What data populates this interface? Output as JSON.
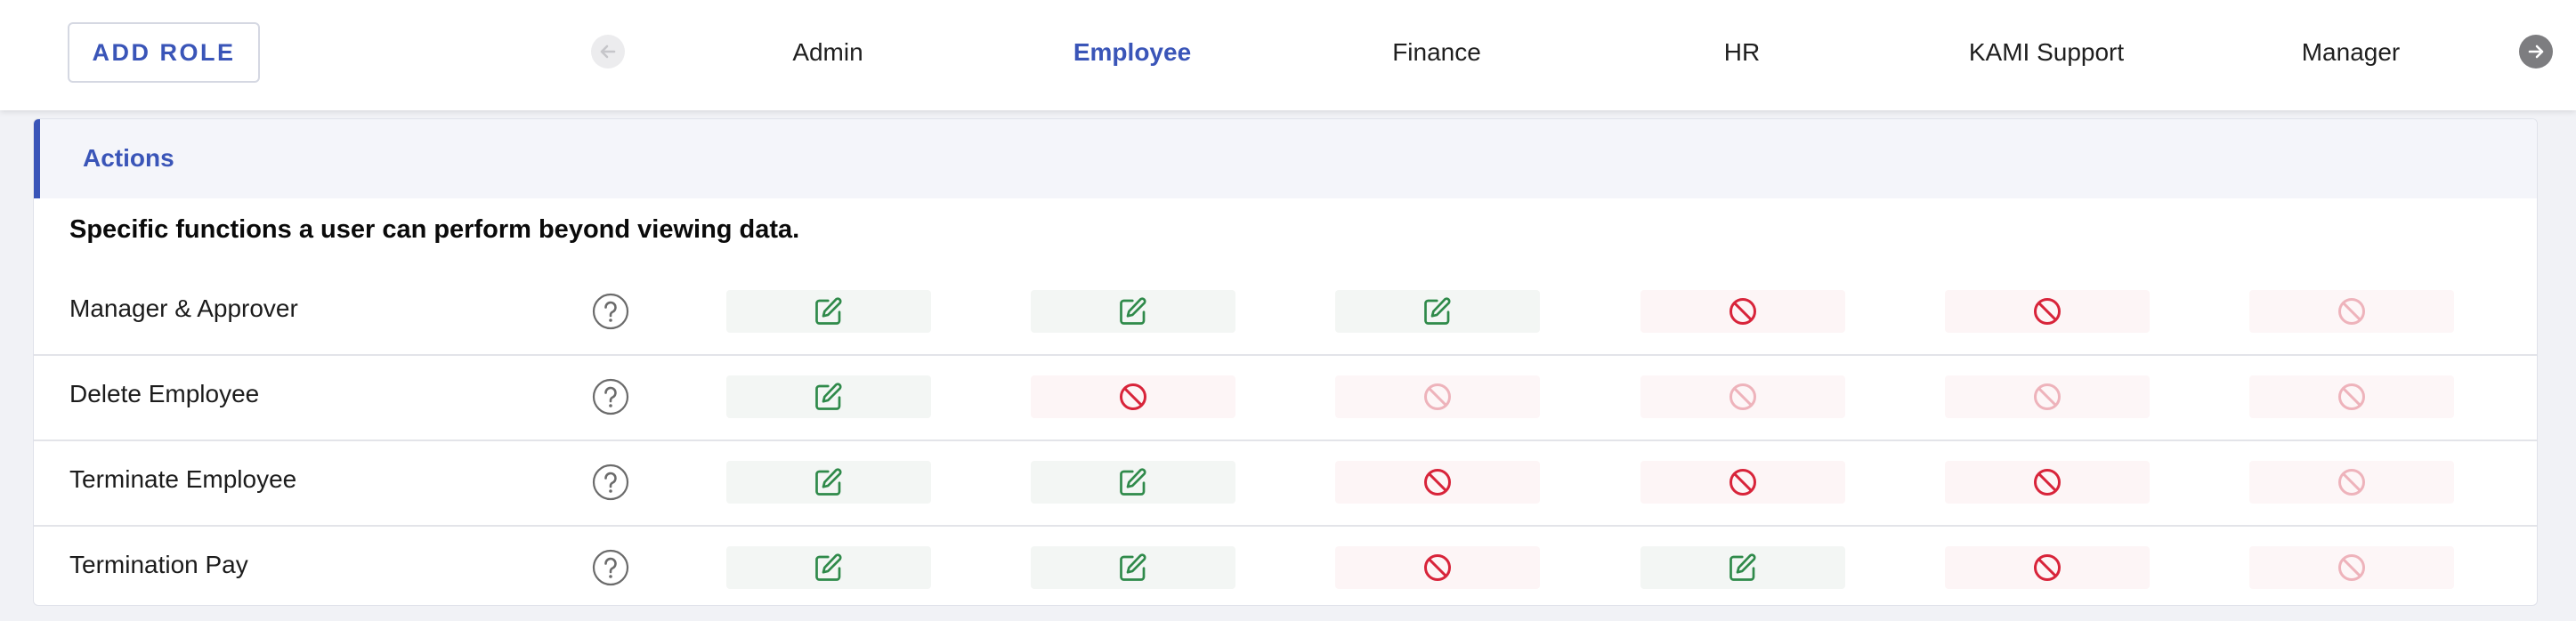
{
  "toolbar": {
    "add_role_label": "ADD ROLE",
    "prev_arrow_icon": "arrow-left-icon",
    "next_arrow_icon": "arrow-right-icon"
  },
  "roles": [
    {
      "label": "Admin",
      "active": false
    },
    {
      "label": "Employee",
      "active": true
    },
    {
      "label": "Finance",
      "active": false
    },
    {
      "label": "HR",
      "active": false
    },
    {
      "label": "KAMI Support",
      "active": false
    },
    {
      "label": "Manager",
      "active": false
    }
  ],
  "section": {
    "title": "Actions",
    "description": "Specific functions a user can perform beyond viewing data."
  },
  "permissions": [
    {
      "label": "Manager & Approver",
      "cells": [
        "edit",
        "edit",
        "edit",
        "deny",
        "deny",
        "disabled"
      ]
    },
    {
      "label": "Delete Employee",
      "cells": [
        "edit",
        "deny",
        "disabled",
        "disabled",
        "disabled",
        "disabled"
      ]
    },
    {
      "label": "Terminate Employee",
      "cells": [
        "edit",
        "edit",
        "deny",
        "deny",
        "deny",
        "disabled"
      ]
    },
    {
      "label": "Termination Pay",
      "cells": [
        "edit",
        "edit",
        "deny",
        "edit",
        "deny",
        "disabled"
      ]
    }
  ],
  "icons": {
    "edit": "edit-icon",
    "deny": "ban-icon",
    "disabled": "ban-icon-disabled",
    "help": "question-circle-icon"
  },
  "colors": {
    "accent": "#3a55b8",
    "allow_green": "#2f8a4a",
    "deny_red": "#d8243a",
    "disabled_red": "#eeb3bb"
  }
}
